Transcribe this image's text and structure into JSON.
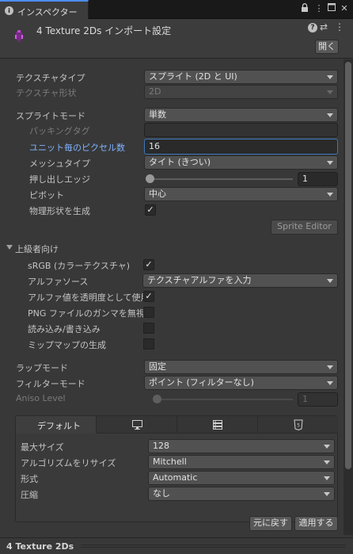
{
  "tab": {
    "title": "インスペクター"
  },
  "header": {
    "title": "4 Texture 2Ds インポート設定",
    "open_label": "開く"
  },
  "fields": {
    "texture_type": {
      "label": "テクスチャタイプ",
      "value": "スプライト (2D と UI)"
    },
    "texture_shape": {
      "label": "テクスチャ形状",
      "value": "2D"
    },
    "sprite_mode": {
      "label": "スプライトモード",
      "value": "単数"
    },
    "packing_tag": {
      "label": "パッキングタグ",
      "value": ""
    },
    "pixels_per_unit": {
      "label": "ユニット毎のピクセル数",
      "value": "16"
    },
    "mesh_type": {
      "label": "メッシュタイプ",
      "value": "タイト (きつい)"
    },
    "extrude_edges": {
      "label": "押し出しエッジ",
      "value": "1",
      "fraction": 0.0
    },
    "pivot": {
      "label": "ピボット",
      "value": "中心"
    },
    "generate_physics": {
      "label": "物理形状を生成",
      "checked": true
    }
  },
  "sprite_editor_label": "Sprite Editor",
  "advanced": {
    "label": "上級者向け",
    "srgb": {
      "label": "sRGB (カラーテクスチャ)",
      "checked": true
    },
    "alpha_source": {
      "label": "アルファソース",
      "value": "テクスチャアルファを入力"
    },
    "alpha_transparency": {
      "label": "アルファ値を透明度として使用",
      "checked": true
    },
    "ignore_png_gamma": {
      "label": "PNG ファイルのガンマを無視",
      "checked": false
    },
    "read_write": {
      "label": "読み込み/書き込み",
      "checked": false
    },
    "mipmaps": {
      "label": "ミップマップの生成",
      "checked": false
    }
  },
  "wrap_mode": {
    "label": "ラップモード",
    "value": "固定"
  },
  "filter_mode": {
    "label": "フィルターモード",
    "value": "ポイント (フィルターなし)"
  },
  "aniso": {
    "label": "Aniso Level",
    "value": "1",
    "fraction": 0.0
  },
  "platform": {
    "tabs": [
      "デフォルト",
      "monitor-icon",
      "server-icon",
      "html5-icon"
    ],
    "max_size": {
      "label": "最大サイズ",
      "value": "128"
    },
    "resize_algorithm": {
      "label": "アルゴリズムをリサイズ",
      "value": "Mitchell"
    },
    "format": {
      "label": "形式",
      "value": "Automatic"
    },
    "compression": {
      "label": "圧縮",
      "value": "なし"
    }
  },
  "buttons": {
    "revert": "元に戻す",
    "apply": "適用する"
  },
  "footer": {
    "title": "4 Texture 2Ds"
  },
  "colors": {
    "accent": "#4d8df0",
    "focus": "#3a79bb",
    "panel": "#383838"
  }
}
